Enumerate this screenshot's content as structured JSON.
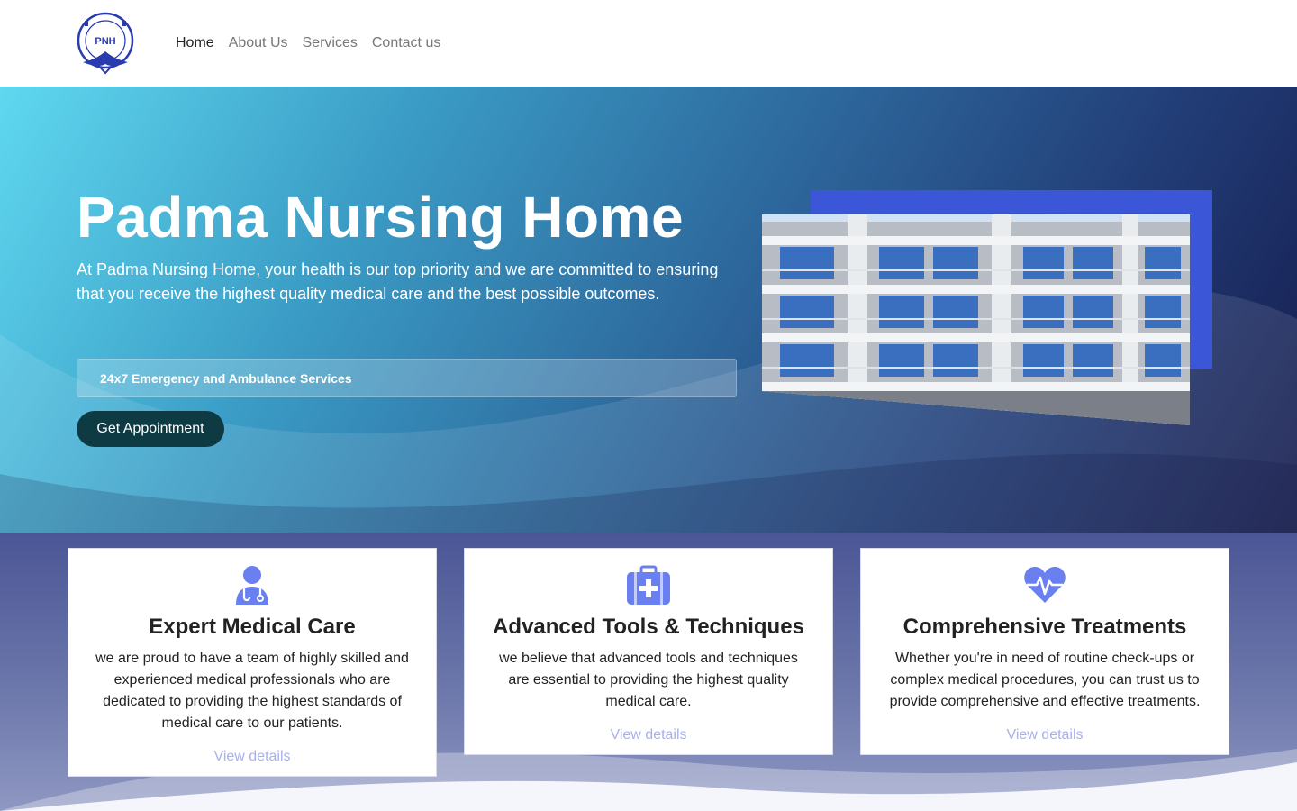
{
  "nav": {
    "logo_text": "PADMA NURSING HOME · PNH",
    "links": [
      "Home",
      "About Us",
      "Services",
      "Contact us"
    ],
    "active_index": 0
  },
  "hero": {
    "title": "Padma Nursing Home",
    "description": "At Padma Nursing Home, your health is our top priority and we are committed to ensuring that you receive the highest quality medical care and the best possible outcomes.",
    "emergency": "24x7 Emergency and Ambulance Services",
    "button": "Get Appointment"
  },
  "features": [
    {
      "icon": "doctor-stethoscope-icon",
      "title": "Expert Medical Care",
      "text": "we are proud to have a team of highly skilled and experienced medical professionals who are dedicated to providing the highest standards of medical care to our patients.",
      "link": "View details"
    },
    {
      "icon": "medical-kit-icon",
      "title": "Advanced Tools & Techniques",
      "text": "we believe that advanced tools and techniques are essential to providing the highest quality medical care.",
      "link": "View details"
    },
    {
      "icon": "heartbeat-icon",
      "title": "Comprehensive Treatments",
      "text": "Whether you're in need of routine check-ups or complex medical procedures, you can trust us to provide comprehensive and effective treatments.",
      "link": "View details"
    }
  ],
  "colors": {
    "accent": "#6b80f0",
    "button": "#0e3a44",
    "link": "#a7b0f0",
    "photo_accent": "#3b56d6"
  }
}
